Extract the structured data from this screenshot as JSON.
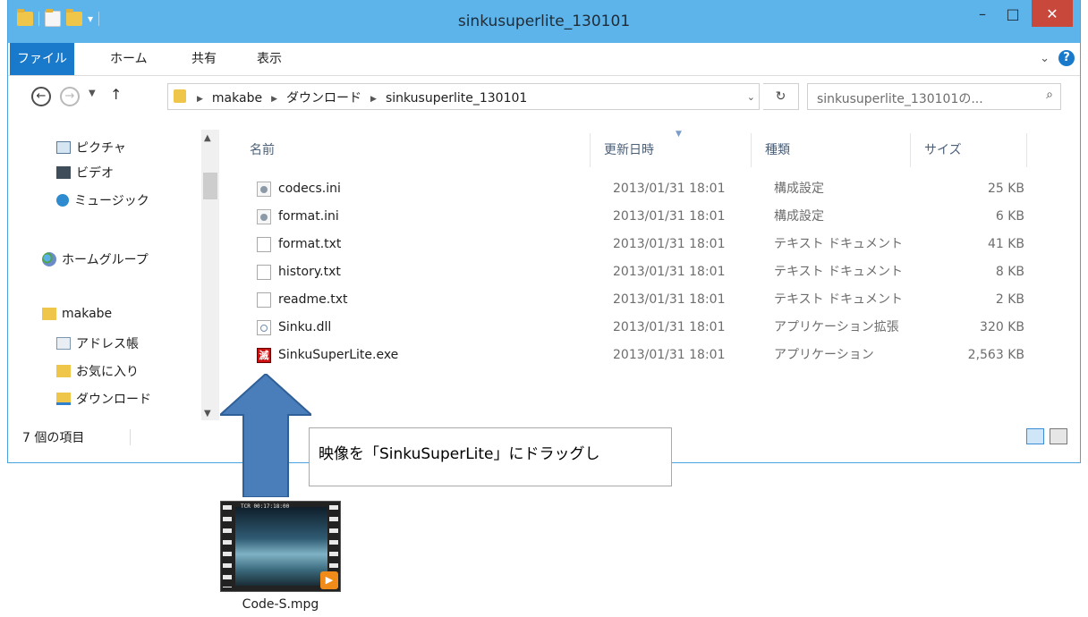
{
  "window": {
    "title": "sinkusuperlite_130101",
    "min_label": "–",
    "max_label": "□",
    "close_label": "✕"
  },
  "ribbon": {
    "tabs": [
      {
        "label": "ファイル"
      },
      {
        "label": "ホーム"
      },
      {
        "label": "共有"
      },
      {
        "label": "表示"
      }
    ],
    "chevron": "⌄",
    "help": "?"
  },
  "address": {
    "crumbs": [
      "makabe",
      "ダウンロード",
      "sinkusuperlite_130101"
    ],
    "search_placeholder": "sinkusuperlite_130101の...",
    "refresh_icon": "↻",
    "search_icon": "⌕"
  },
  "nav_pane": {
    "items": [
      {
        "label": "ピクチャ",
        "icon": "pictures-icon"
      },
      {
        "label": "ビデオ",
        "icon": "videos-icon"
      },
      {
        "label": "ミュージック",
        "icon": "music-icon"
      },
      {
        "label": "ホームグループ",
        "icon": "homegroup-icon"
      },
      {
        "label": "makabe",
        "icon": "user-folder-icon"
      },
      {
        "label": "アドレス帳",
        "icon": "contacts-icon"
      },
      {
        "label": "お気に入り",
        "icon": "favorites-icon"
      },
      {
        "label": "ダウンロード",
        "icon": "downloads-icon"
      }
    ]
  },
  "columns": {
    "name": "名前",
    "date": "更新日時",
    "type": "種類",
    "size": "サイズ"
  },
  "files": [
    {
      "name": "codecs.ini",
      "date": "2013/01/31 18:01",
      "type": "構成設定",
      "size": "25 KB",
      "icon": "ini-file-icon"
    },
    {
      "name": "format.ini",
      "date": "2013/01/31 18:01",
      "type": "構成設定",
      "size": "6 KB",
      "icon": "ini-file-icon"
    },
    {
      "name": "format.txt",
      "date": "2013/01/31 18:01",
      "type": "テキスト ドキュメント",
      "size": "41 KB",
      "icon": "text-file-icon"
    },
    {
      "name": "history.txt",
      "date": "2013/01/31 18:01",
      "type": "テキスト ドキュメント",
      "size": "8 KB",
      "icon": "text-file-icon"
    },
    {
      "name": "readme.txt",
      "date": "2013/01/31 18:01",
      "type": "テキスト ドキュメント",
      "size": "2 KB",
      "icon": "text-file-icon"
    },
    {
      "name": "Sinku.dll",
      "date": "2013/01/31 18:01",
      "type": "アプリケーション拡張",
      "size": "320 KB",
      "icon": "dll-file-icon"
    },
    {
      "name": "SinkuSuperLite.exe",
      "date": "2013/01/31 18:01",
      "type": "アプリケーション",
      "size": "2,563 KB",
      "icon": "exe-app-icon"
    }
  ],
  "status": {
    "item_count": "7 個の項目"
  },
  "annotation": {
    "callout": "映像を「SinkuSuperLite」にドラッグし",
    "arrow_color": "#4a7ebb"
  },
  "desktop_file": {
    "label": "Code-S.mpg",
    "timecode": "TCR 00:17:18:00",
    "play": "▶"
  },
  "colors": {
    "titlebar": "#5db4ea",
    "file_tab": "#1979ca",
    "close_button": "#c9483c"
  }
}
